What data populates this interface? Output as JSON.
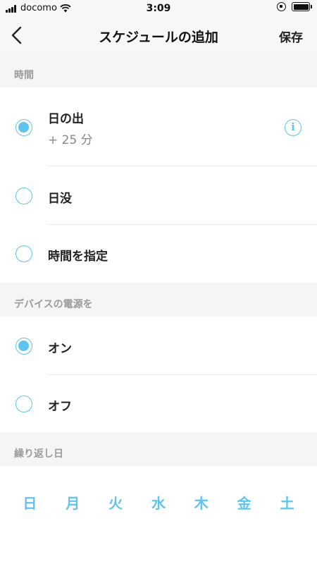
{
  "status": {
    "carrier": "docomo",
    "time": "3:09"
  },
  "nav": {
    "title": "スケジュールの追加",
    "save_label": "保存"
  },
  "sections": {
    "time_header": "時間",
    "power_header": "デバイスの電源を",
    "repeat_header": "繰り返し日"
  },
  "time_options": [
    {
      "label": "日の出",
      "sub": "+ 25 分",
      "selected": true
    },
    {
      "label": "日没",
      "selected": false
    },
    {
      "label": "時間を指定",
      "selected": false
    }
  ],
  "power_options": [
    {
      "label": "オン",
      "selected": true
    },
    {
      "label": "オフ",
      "selected": false
    }
  ],
  "days": [
    "日",
    "月",
    "火",
    "水",
    "木",
    "金",
    "土"
  ],
  "colors": {
    "accent": "#5ec4ee",
    "section_bg": "#f5f5f5"
  }
}
